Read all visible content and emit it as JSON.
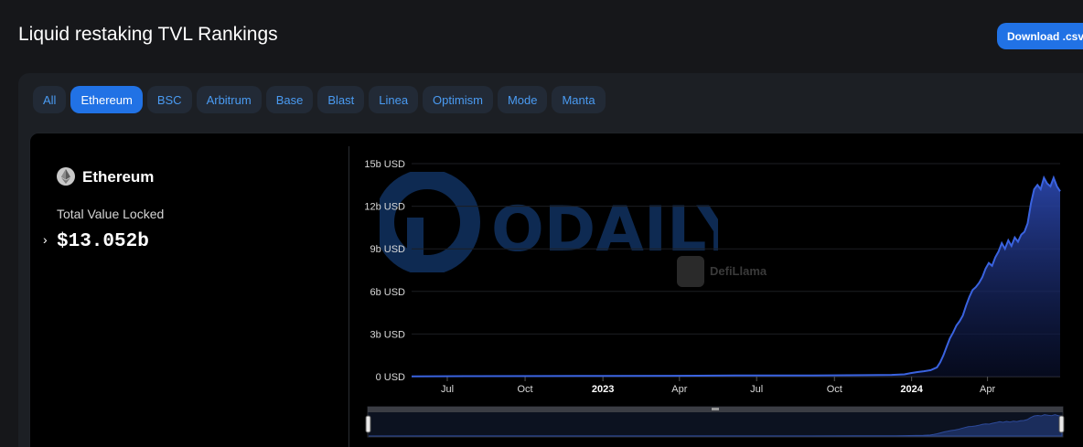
{
  "page": {
    "title": "Liquid restaking TVL Rankings"
  },
  "toolbar": {
    "download_label": "Download .csv"
  },
  "tabs": [
    "All",
    "Ethereum",
    "BSC",
    "Arbitrum",
    "Base",
    "Blast",
    "Linea",
    "Optimism",
    "Mode",
    "Manta"
  ],
  "active_tab": "Ethereum",
  "summary": {
    "chain_name": "Ethereum",
    "chain_icon": "ethereum-icon",
    "tvl_label": "Total Value Locked",
    "tvl_value": "$13.052b"
  },
  "watermarks": {
    "odaily": "ODAILY",
    "defillama": "DefiLlama"
  },
  "colors": {
    "line": "#3a63e0",
    "accent": "#2172e5",
    "tab_text": "#4a9bf2"
  },
  "chart_data": {
    "type": "area",
    "title": "",
    "xlabel": "",
    "ylabel": "",
    "ylim": [
      0,
      15
    ],
    "y_unit": "b USD",
    "y_ticks": [
      "0 USD",
      "3b USD",
      "6b USD",
      "9b USD",
      "12b USD",
      "15b USD"
    ],
    "x_ticks": [
      {
        "label": "Jul",
        "t": 0.055,
        "bold": false
      },
      {
        "label": "Oct",
        "t": 0.175,
        "bold": false
      },
      {
        "label": "2023",
        "t": 0.295,
        "bold": true
      },
      {
        "label": "Apr",
        "t": 0.413,
        "bold": false
      },
      {
        "label": "Jul",
        "t": 0.532,
        "bold": false
      },
      {
        "label": "Oct",
        "t": 0.652,
        "bold": false
      },
      {
        "label": "2024",
        "t": 0.771,
        "bold": true
      },
      {
        "label": "Apr",
        "t": 0.888,
        "bold": false
      }
    ],
    "series": [
      {
        "points": [
          [
            0.0,
            0.02
          ],
          [
            0.1,
            0.03
          ],
          [
            0.2,
            0.04
          ],
          [
            0.3,
            0.05
          ],
          [
            0.4,
            0.06
          ],
          [
            0.5,
            0.08
          ],
          [
            0.6,
            0.08
          ],
          [
            0.7,
            0.1
          ],
          [
            0.74,
            0.12
          ],
          [
            0.76,
            0.16
          ],
          [
            0.77,
            0.25
          ],
          [
            0.78,
            0.32
          ],
          [
            0.79,
            0.38
          ],
          [
            0.8,
            0.45
          ],
          [
            0.81,
            0.65
          ],
          [
            0.815,
            1.0
          ],
          [
            0.82,
            1.5
          ],
          [
            0.825,
            2.1
          ],
          [
            0.83,
            2.7
          ],
          [
            0.835,
            3.1
          ],
          [
            0.84,
            3.6
          ],
          [
            0.845,
            3.9
          ],
          [
            0.85,
            4.3
          ],
          [
            0.855,
            5.0
          ],
          [
            0.86,
            5.6
          ],
          [
            0.865,
            6.1
          ],
          [
            0.87,
            6.3
          ],
          [
            0.875,
            6.6
          ],
          [
            0.88,
            7.0
          ],
          [
            0.885,
            7.6
          ],
          [
            0.89,
            8.0
          ],
          [
            0.895,
            7.8
          ],
          [
            0.9,
            8.4
          ],
          [
            0.905,
            8.8
          ],
          [
            0.91,
            9.4
          ],
          [
            0.915,
            9.0
          ],
          [
            0.92,
            9.6
          ],
          [
            0.925,
            9.2
          ],
          [
            0.93,
            9.8
          ],
          [
            0.935,
            9.5
          ],
          [
            0.94,
            10.0
          ],
          [
            0.945,
            10.2
          ],
          [
            0.95,
            10.8
          ],
          [
            0.955,
            12.2
          ],
          [
            0.96,
            13.2
          ],
          [
            0.965,
            13.5
          ],
          [
            0.97,
            13.2
          ],
          [
            0.975,
            14.0
          ],
          [
            0.98,
            13.6
          ],
          [
            0.985,
            13.4
          ],
          [
            0.99,
            14.0
          ],
          [
            0.995,
            13.4
          ],
          [
            1.0,
            13.05
          ]
        ]
      }
    ]
  }
}
